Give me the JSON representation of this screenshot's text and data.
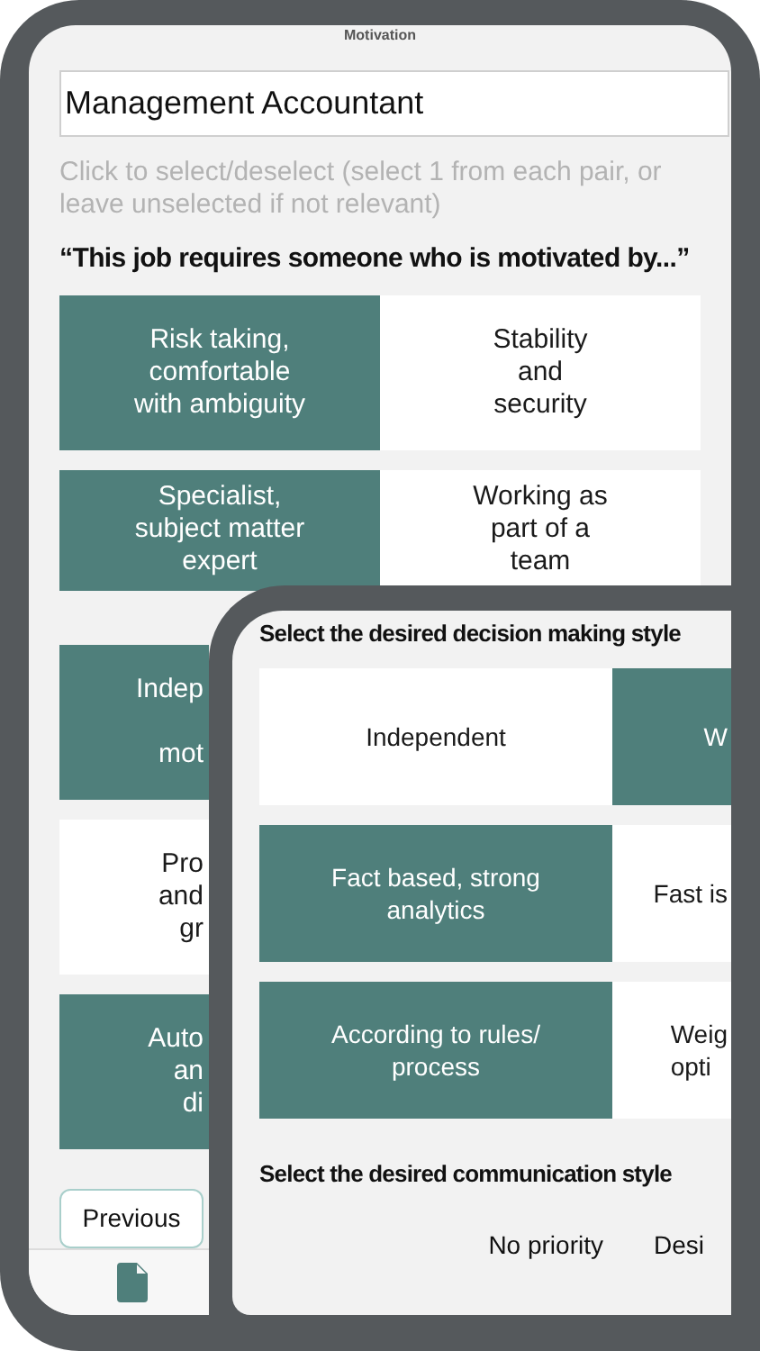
{
  "back_screen": {
    "header": "Motivation",
    "job_title": "Management Accountant",
    "hint": "Click to select/deselect (select 1 from each pair, or leave unselected if not relevant)",
    "question": "“This job requires someone who is motivated by...”",
    "pairs": [
      {
        "left": {
          "text": "Risk taking,\ncomfortable\nwith ambiguity",
          "selected": true
        },
        "right": {
          "text": "Stability\nand\nsecurity",
          "selected": false
        }
      },
      {
        "left": {
          "text": "Specialist,\nsubject matter\nexpert",
          "selected": true
        },
        "right": {
          "text": "Working as\npart of a\nteam",
          "selected": false
        }
      },
      {
        "left": {
          "text": "Indep\n\nmot",
          "selected": true
        }
      },
      {
        "left": {
          "text": "Pro\nand\ngr",
          "selected": false
        }
      },
      {
        "left": {
          "text": "Auto\nan\ndi",
          "selected": true
        }
      }
    ],
    "previous_button": "Previous"
  },
  "front_screen": {
    "decision_heading": "Select the desired decision making style",
    "decision_pairs": [
      {
        "left": {
          "text": "Independent",
          "selected": false
        },
        "right": {
          "text": "W",
          "selected": true
        }
      },
      {
        "left": {
          "text": "Fact based, strong\nanalytics",
          "selected": true
        },
        "right": {
          "text": "Fast is",
          "selected": false
        }
      },
      {
        "left": {
          "text": "According to rules/\nprocess",
          "selected": true
        },
        "right": {
          "text": "Weig\nopti",
          "selected": false
        }
      }
    ],
    "communication_heading": "Select the desired communication style",
    "columns": [
      "No priority",
      "Desi"
    ]
  }
}
